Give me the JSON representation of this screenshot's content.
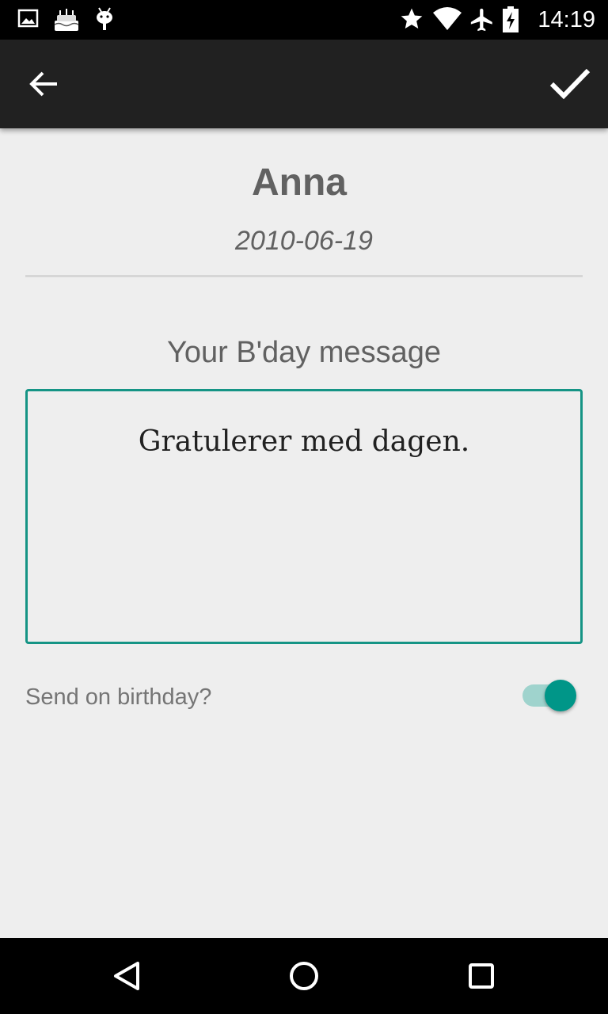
{
  "status_bar": {
    "time": "14:19",
    "left_icons": [
      "image-notification-icon",
      "birthday-cake-icon",
      "android-debug-icon"
    ],
    "right_icons": [
      "star-icon",
      "wifi-icon",
      "airplane-mode-icon",
      "battery-charging-icon"
    ]
  },
  "app_bar": {
    "back_icon": "arrow-back-icon",
    "save_icon": "checkmark-icon"
  },
  "contact": {
    "name": "Anna",
    "birthday": "2010-06-19"
  },
  "message": {
    "label": "Your B'day message",
    "text": "Gratulerer med dagen."
  },
  "send_option": {
    "label": "Send on birthday?",
    "enabled": true
  },
  "nav_bar": {
    "icons": [
      "back-triangle-icon",
      "home-circle-icon",
      "recents-square-icon"
    ]
  },
  "colors": {
    "accent": "#009688",
    "toolbar": "#212121",
    "background": "#eeeeee"
  }
}
